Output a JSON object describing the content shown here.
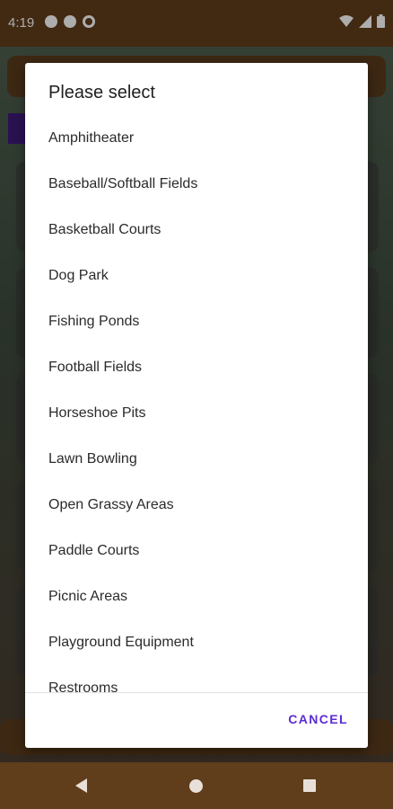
{
  "status_bar": {
    "time": "4:19"
  },
  "dialog": {
    "title": "Please select",
    "options": [
      "Amphitheater",
      "Baseball/Softball Fields",
      "Basketball Courts",
      "Dog Park",
      "Fishing Ponds",
      "Football Fields",
      "Horseshoe Pits",
      "Lawn Bowling",
      "Open Grassy Areas",
      "Paddle Courts",
      "Picnic Areas",
      "Playground Equipment",
      "Restrooms"
    ],
    "cancel_label": "CANCEL"
  },
  "colors": {
    "accent": "#5b2bd6",
    "bar_brown": "#603d1b"
  },
  "icons": [
    "vpn-icon",
    "circle-icon",
    "sync-icon",
    "wifi-icon",
    "signal-icon",
    "battery-icon",
    "back-icon",
    "home-icon",
    "recents-icon"
  ]
}
